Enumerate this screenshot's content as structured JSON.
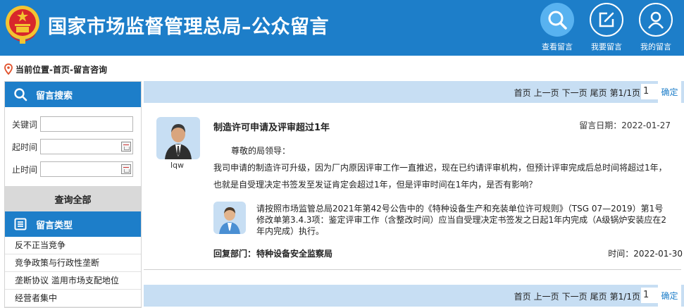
{
  "header": {
    "title": "国家市场监督管理总局–公众留言",
    "nav": [
      {
        "label": "查看留言",
        "icon": "search-icon"
      },
      {
        "label": "我要留言",
        "icon": "edit-icon"
      },
      {
        "label": "我的留言",
        "icon": "user-icon"
      }
    ],
    "emblem": "national-emblem"
  },
  "breadcrumb": {
    "text": "当前位置-首页-留言咨询",
    "icon": "location-pin-icon"
  },
  "sidebar": {
    "search_title": "留言搜索",
    "fields": {
      "keyword_label": "关键词",
      "start_label": "起时间",
      "end_label": "止时间"
    },
    "query_all": "查询全部",
    "types_title": "留言类型",
    "types": [
      "反不正当竞争",
      "竞争政策与行政性垄断",
      "垄断协议 滥用市场支配地位",
      "经营者集中"
    ]
  },
  "pager": {
    "first": "首页",
    "prev": "上一页",
    "next": "下一页",
    "last": "尾页",
    "page_info": "第1/1页",
    "page_value": "1",
    "confirm": "确定"
  },
  "message": {
    "user": "lqw",
    "title": "制造许可申请及评审超过1年",
    "date_label": "留言日期：",
    "date": "2022-01-27",
    "greeting": "尊敬的局领导：",
    "body": "我司申请的制造许可升级，因为厂内原因评审工作一直推迟，现在已约请评审机构，但预计评审完成后总时间将超过1年，也就是自受理决定书签发至发证肯定会超过1年，但是评审时间在1年内，是否有影响？",
    "reply": "请按照市场监管总局2021年第42号公告中的《特种设备生产和充装单位许可规则》（TSG 07—2019）第1号修改单第3.4.3项：鉴定评审工作（含整改时间）应当自受理决定书签发之日起1年内完成（A级锅炉安装应在2年内完成）执行。",
    "reply_dept_label": "回复部门：",
    "reply_dept": "特种设备安全监察局",
    "reply_time_label": "时间：",
    "reply_time": "2022-01-30"
  },
  "colors": {
    "brand_blue": "#1d7ec9",
    "pager_bg": "#c7def3",
    "active_nav": "#58b2f0"
  }
}
